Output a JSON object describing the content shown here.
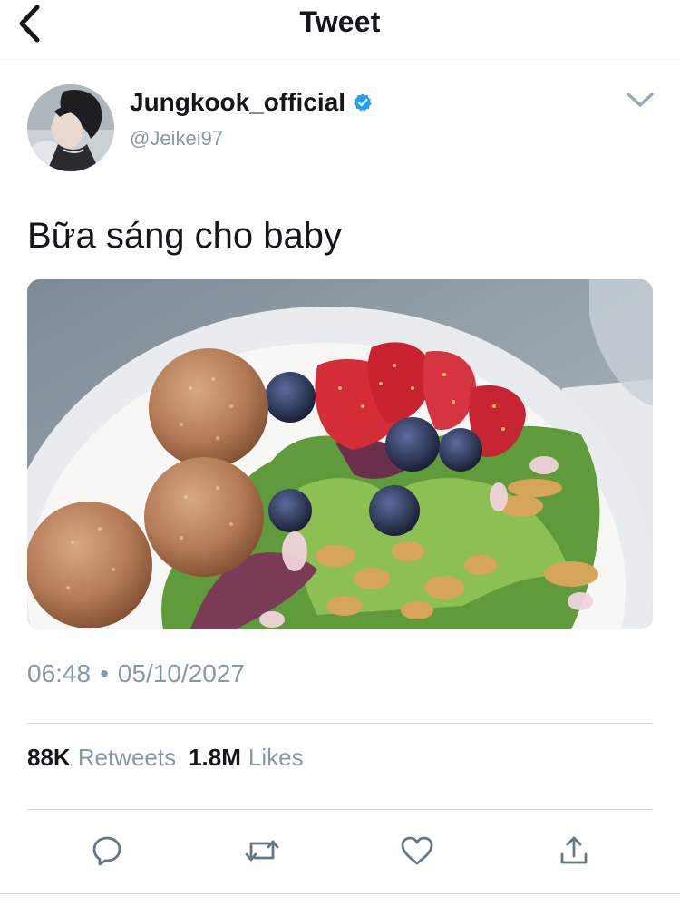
{
  "header": {
    "title": "Tweet"
  },
  "author": {
    "display_name": "Jungkook_official",
    "handle": "@Jeikei97",
    "verified": true
  },
  "tweet": {
    "text": "Bữa sáng cho baby",
    "time": "06:48",
    "separator": "•",
    "date": "05/10/2027"
  },
  "stats": {
    "retweets_count": "88K",
    "retweets_label": "Retweets",
    "likes_count": "1.8M",
    "likes_label": "Likes"
  },
  "icons": {
    "back": "back-chevron-icon",
    "verified": "verified-badge-icon",
    "more": "chevron-down-icon",
    "reply": "reply-icon",
    "retweet": "retweet-icon",
    "like": "heart-icon",
    "share": "share-icon"
  },
  "colors": {
    "primary_text": "#14171a",
    "secondary_text": "#8899a6",
    "divider": "#cfd6dc",
    "verified_blue": "#1da1f2",
    "icon_gray": "#657786"
  }
}
